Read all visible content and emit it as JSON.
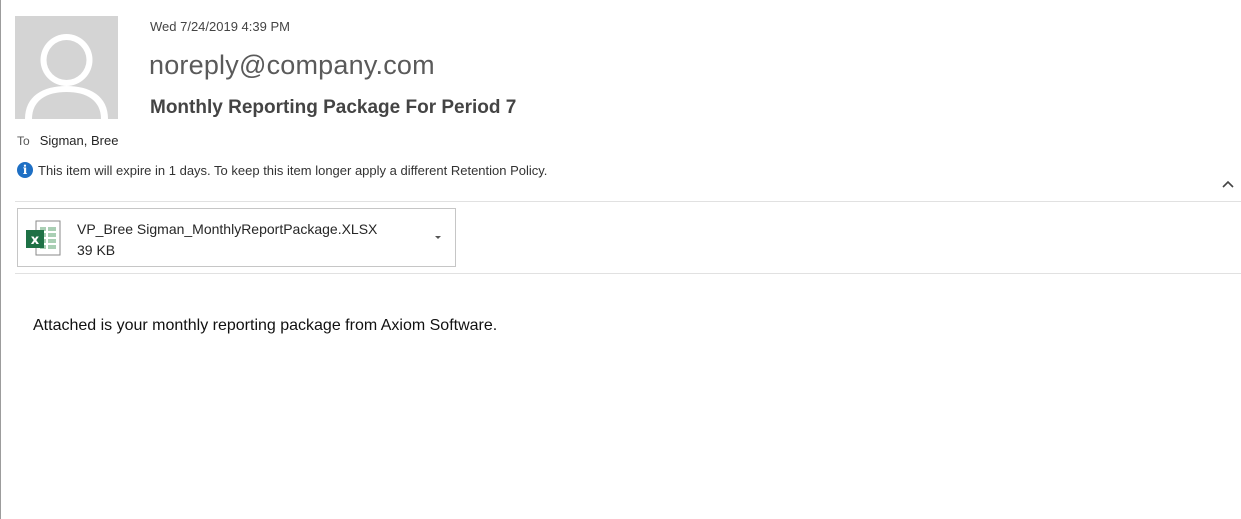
{
  "message": {
    "datetime": "Wed 7/24/2019 4:39 PM",
    "sender": "noreply@company.com",
    "subject": "Monthly Reporting Package For Period 7",
    "to_label": "To",
    "recipient": "Sigman, Bree",
    "retention_notice": "This item will expire in 1 days. To keep this item longer apply a different Retention Policy.",
    "info_icon": "info-icon",
    "collapse_icon": "chevron-up-icon"
  },
  "attachment": {
    "filename": "VP_Bree Sigman_MonthlyReportPackage.XLSX",
    "size": "39 KB",
    "file_icon": "excel-icon",
    "dropdown_icon": "chevron-down-icon"
  },
  "body": {
    "text": "Attached is your monthly reporting package from Axiom Software."
  },
  "colors": {
    "info_blue": "#1e6fc4",
    "excel_green": "#1e7145"
  }
}
